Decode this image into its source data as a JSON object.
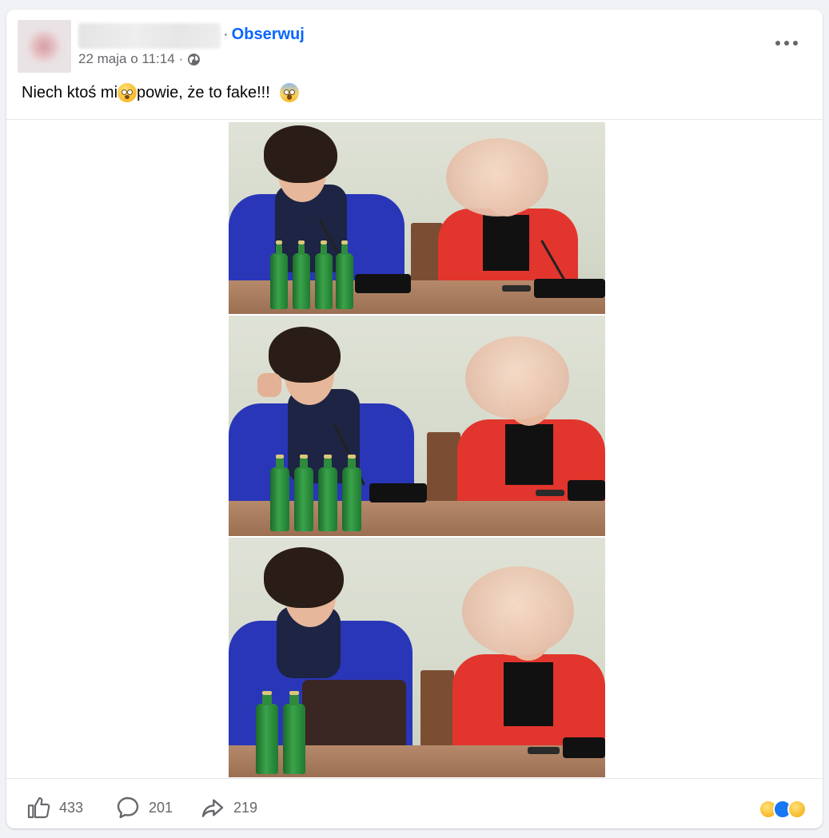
{
  "post": {
    "meta": {
      "date": "22 maja o 11:14",
      "separator": "·"
    },
    "follow_label": "Obserwuj",
    "text_part1": "Niech ktoś mi",
    "text_part2": "powie, że to fake!!!",
    "emoji_inline": "flushed-face",
    "emoji_end": "face-screaming-in-fear"
  },
  "image": {
    "description_panels": 3,
    "icon": "photo"
  },
  "footer": {
    "likes": "433",
    "comments": "201",
    "shares": "219",
    "reaction_icons": [
      "haha",
      "like",
      "wow"
    ]
  },
  "colors": {
    "accent": "#0866ff",
    "meta_text": "#65676b",
    "like_blue": "#1877f2"
  }
}
